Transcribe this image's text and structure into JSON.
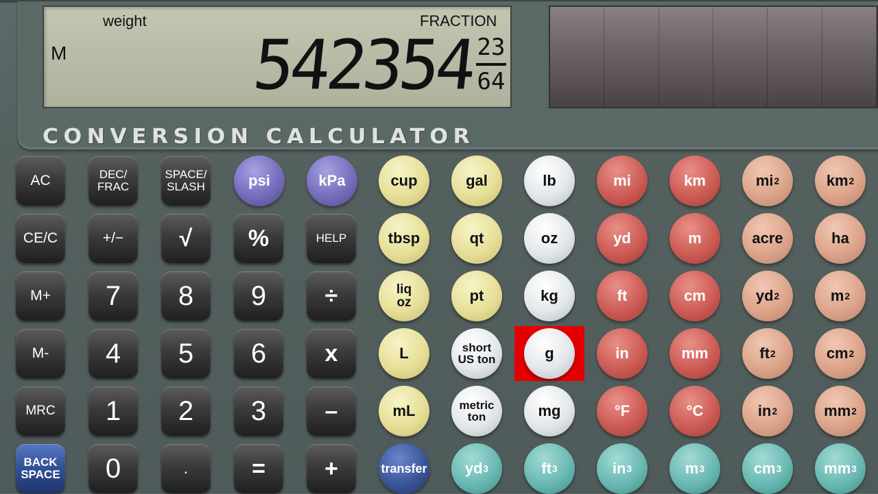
{
  "display": {
    "category": "weight",
    "mode": "FRACTION",
    "memory_indicator": "M",
    "value": "542354",
    "fraction_numerator": "23",
    "fraction_denominator": "64"
  },
  "brand": "CONVERSION CALCULATOR",
  "function_keys": {
    "ac": "AC",
    "dec_frac": "DEC/\nFRAC",
    "space_slash": "SPACE/\nSLASH",
    "ce_c": "CE/C",
    "plus_minus": "+/−",
    "sqrt": "√",
    "percent": "%",
    "help": "HELP",
    "m_plus": "M+",
    "m_minus": "M-",
    "mrc": "MRC",
    "backspace": "BACK\nSPACE",
    "divide": "÷",
    "multiply": "x",
    "minus": "–",
    "plus": "+",
    "equals": "=",
    "decimal": "."
  },
  "digits": {
    "d0": "0",
    "d1": "1",
    "d2": "2",
    "d3": "3",
    "d4": "4",
    "d5": "5",
    "d6": "6",
    "d7": "7",
    "d8": "8",
    "d9": "9"
  },
  "units": {
    "psi": "psi",
    "kpa": "kPa",
    "cup": "cup",
    "tbsp": "tbsp",
    "liq_oz": "liq\noz",
    "liter": "L",
    "ml": "mL",
    "transfer": "transfer",
    "gal": "gal",
    "qt": "qt",
    "pt": "pt",
    "short_ton": "short\nUS ton",
    "metric_ton": "metric\nton",
    "lb": "lb",
    "oz": "oz",
    "kg": "kg",
    "g": "g",
    "mg": "mg",
    "mi": "mi",
    "yd": "yd",
    "ft": "ft",
    "in": "in",
    "deg_f": "°F",
    "km": "km",
    "m": "m",
    "cm": "cm",
    "mm": "mm",
    "deg_c": "°C",
    "acre": "acre",
    "ha": "ha",
    "sq": "2",
    "cube": "3"
  },
  "selected_unit": "g",
  "colors": {
    "selected_highlight": "#e40000"
  }
}
